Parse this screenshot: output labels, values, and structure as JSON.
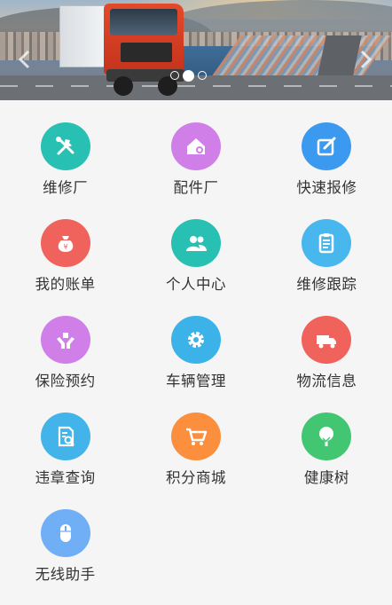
{
  "carousel": {
    "slide_count": 3,
    "active_index": 1
  },
  "menu": [
    {
      "label": "维修厂",
      "icon": "tools-icon",
      "color": "#27c0b3"
    },
    {
      "label": "配件厂",
      "icon": "house-gear-icon",
      "color": "#d07ee8"
    },
    {
      "label": "快速报修",
      "icon": "edit-note-icon",
      "color": "#3b9af0"
    },
    {
      "label": "我的账单",
      "icon": "money-bag-icon",
      "color": "#f0625c"
    },
    {
      "label": "个人中心",
      "icon": "users-icon",
      "color": "#27c0b3"
    },
    {
      "label": "维修跟踪",
      "icon": "clipboard-icon",
      "color": "#47b7ee"
    },
    {
      "label": "保险预约",
      "icon": "hands-shield-icon",
      "color": "#d07ee8"
    },
    {
      "label": "车辆管理",
      "icon": "gear-icon",
      "color": "#3cb3e8"
    },
    {
      "label": "物流信息",
      "icon": "truck-icon",
      "color": "#f0625c"
    },
    {
      "label": "违章查询",
      "icon": "document-search-icon",
      "color": "#42b4ea"
    },
    {
      "label": "积分商城",
      "icon": "cart-icon",
      "color": "#fb8f3d"
    },
    {
      "label": "健康树",
      "icon": "tree-icon",
      "color": "#43c671"
    },
    {
      "label": "无线助手",
      "icon": "mouse-icon",
      "color": "#70aef5"
    }
  ]
}
